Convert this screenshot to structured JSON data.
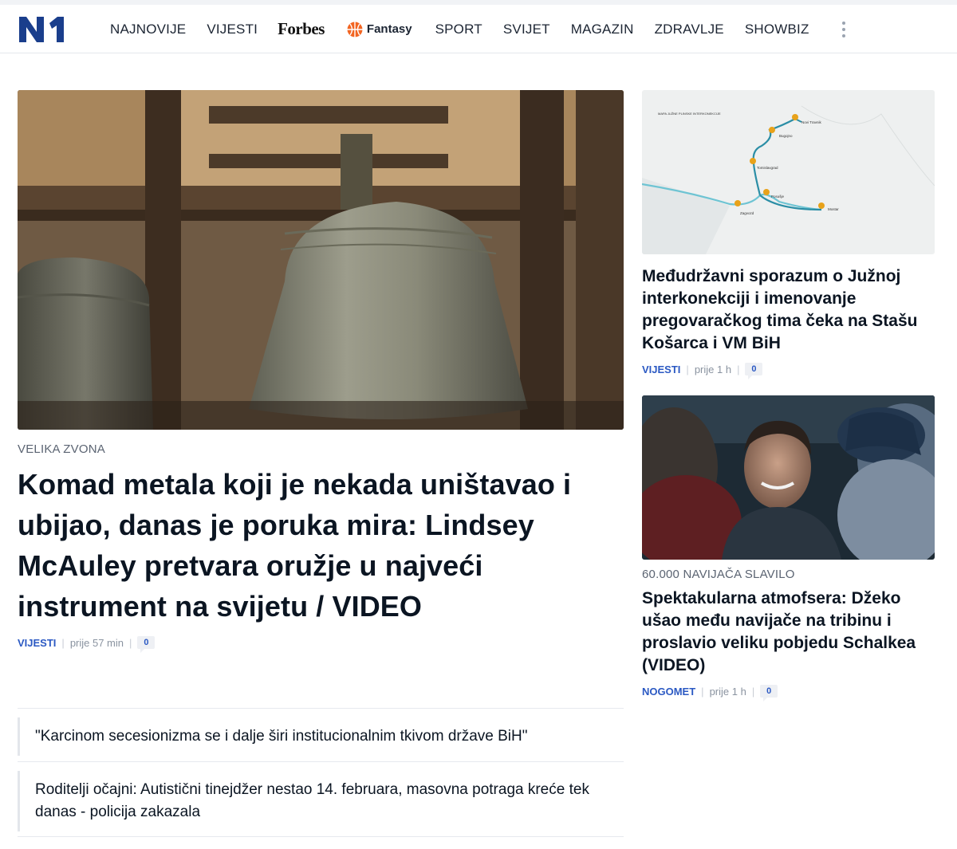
{
  "brand": {
    "logo_text": "N1"
  },
  "nav": {
    "items": [
      "NAJNOVIJE",
      "VIJESTI"
    ],
    "forbes": "Forbes",
    "fantasy": "Fantasy",
    "items_right": [
      "SPORT",
      "SVIJET",
      "MAGAZIN",
      "ZDRAVLJE",
      "SHOWBIZ"
    ],
    "more_icon": "more-vertical-icon"
  },
  "main_article": {
    "image": "church-bells-photo",
    "kicker": "VELIKA ZVONA",
    "title": "Komad metala koji je nekada uništavao i ubijao, danas je poruka mira: Lindsey McAuley pretvara oružje u najveći instrument na svijetu / VIDEO",
    "category": "VIJESTI",
    "time": "prije 57 min",
    "comments": "0"
  },
  "related": [
    {
      "title": "\"Karcinom secesionizma se i dalje širi institucionalnim tkivom države BiH\""
    },
    {
      "title": "Roditelji očajni: Autistični tinejdžer nestao 14. februara, masovna potraga kreće tek danas - policija zakazala"
    }
  ],
  "side_articles": [
    {
      "image": "pipeline-map",
      "kicker": "",
      "title": "Međudržavni sporazum o Južnoj interkonekciji i imenovanje pregovaračkog tima čeka na Stašu Košarca i VM BiH",
      "category": "VIJESTI",
      "time": "prije 1 h",
      "comments": "0",
      "map": {
        "heading": "MAPA JUŽNE PLINSKE INTERKONEKCIJE",
        "cities": [
          "Novi Travnik",
          "Bugojno",
          "Tomislavgrad",
          "Posušje",
          "Zagvozd",
          "Mostar"
        ]
      }
    },
    {
      "image": "stadium-crowd-photo",
      "kicker": "60.000 NAVIJAČA SLAVILO",
      "title": "Spektakularna atmofsera: Džeko ušao među navijače na tribinu i proslavio veliku pobjedu Schalkea (VIDEO)",
      "category": "NOGOMET",
      "time": "prije 1 h",
      "comments": "0"
    }
  ],
  "colors": {
    "accent": "#2b59c3",
    "logo": "#1a3e8c",
    "fantasy": "#f26522"
  }
}
